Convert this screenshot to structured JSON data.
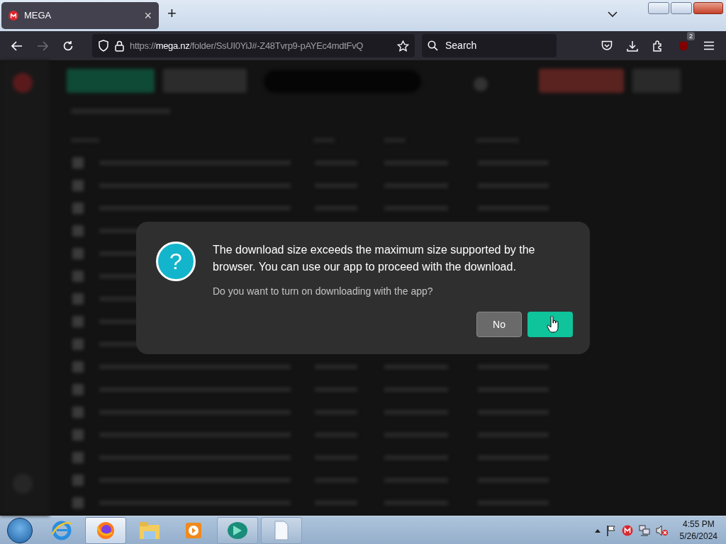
{
  "browser": {
    "tab": {
      "title": "MEGA",
      "close": "×",
      "selected": true
    },
    "new_tab": "+",
    "url": {
      "scheme": "https://",
      "host": "mega.nz",
      "path": "/folder/SsUI0YiJ#-Z48Tvrp9-pAYEc4mdtFvQ"
    },
    "search": {
      "placeholder": "Search"
    },
    "extension_badge": "2"
  },
  "dialog": {
    "icon_glyph": "?",
    "message": "The download size exceeds the maximum size supported by the browser. You can use our app to proceed with the download.",
    "question": "Do you want to turn on downloading with the app?",
    "buttons": [
      {
        "kind": "secondary",
        "label": "No"
      },
      {
        "kind": "primary"
      }
    ]
  },
  "taskbar": {
    "apps": [
      {
        "kind": "ie",
        "selected": false
      },
      {
        "kind": "firefox",
        "selected": true
      },
      {
        "kind": "explorer",
        "selected": false
      },
      {
        "kind": "media",
        "selected": false
      },
      {
        "kind": "green",
        "selected": false
      },
      {
        "kind": "document",
        "selected": false
      }
    ],
    "time": "4:55 PM",
    "date": "5/26/2024"
  }
}
